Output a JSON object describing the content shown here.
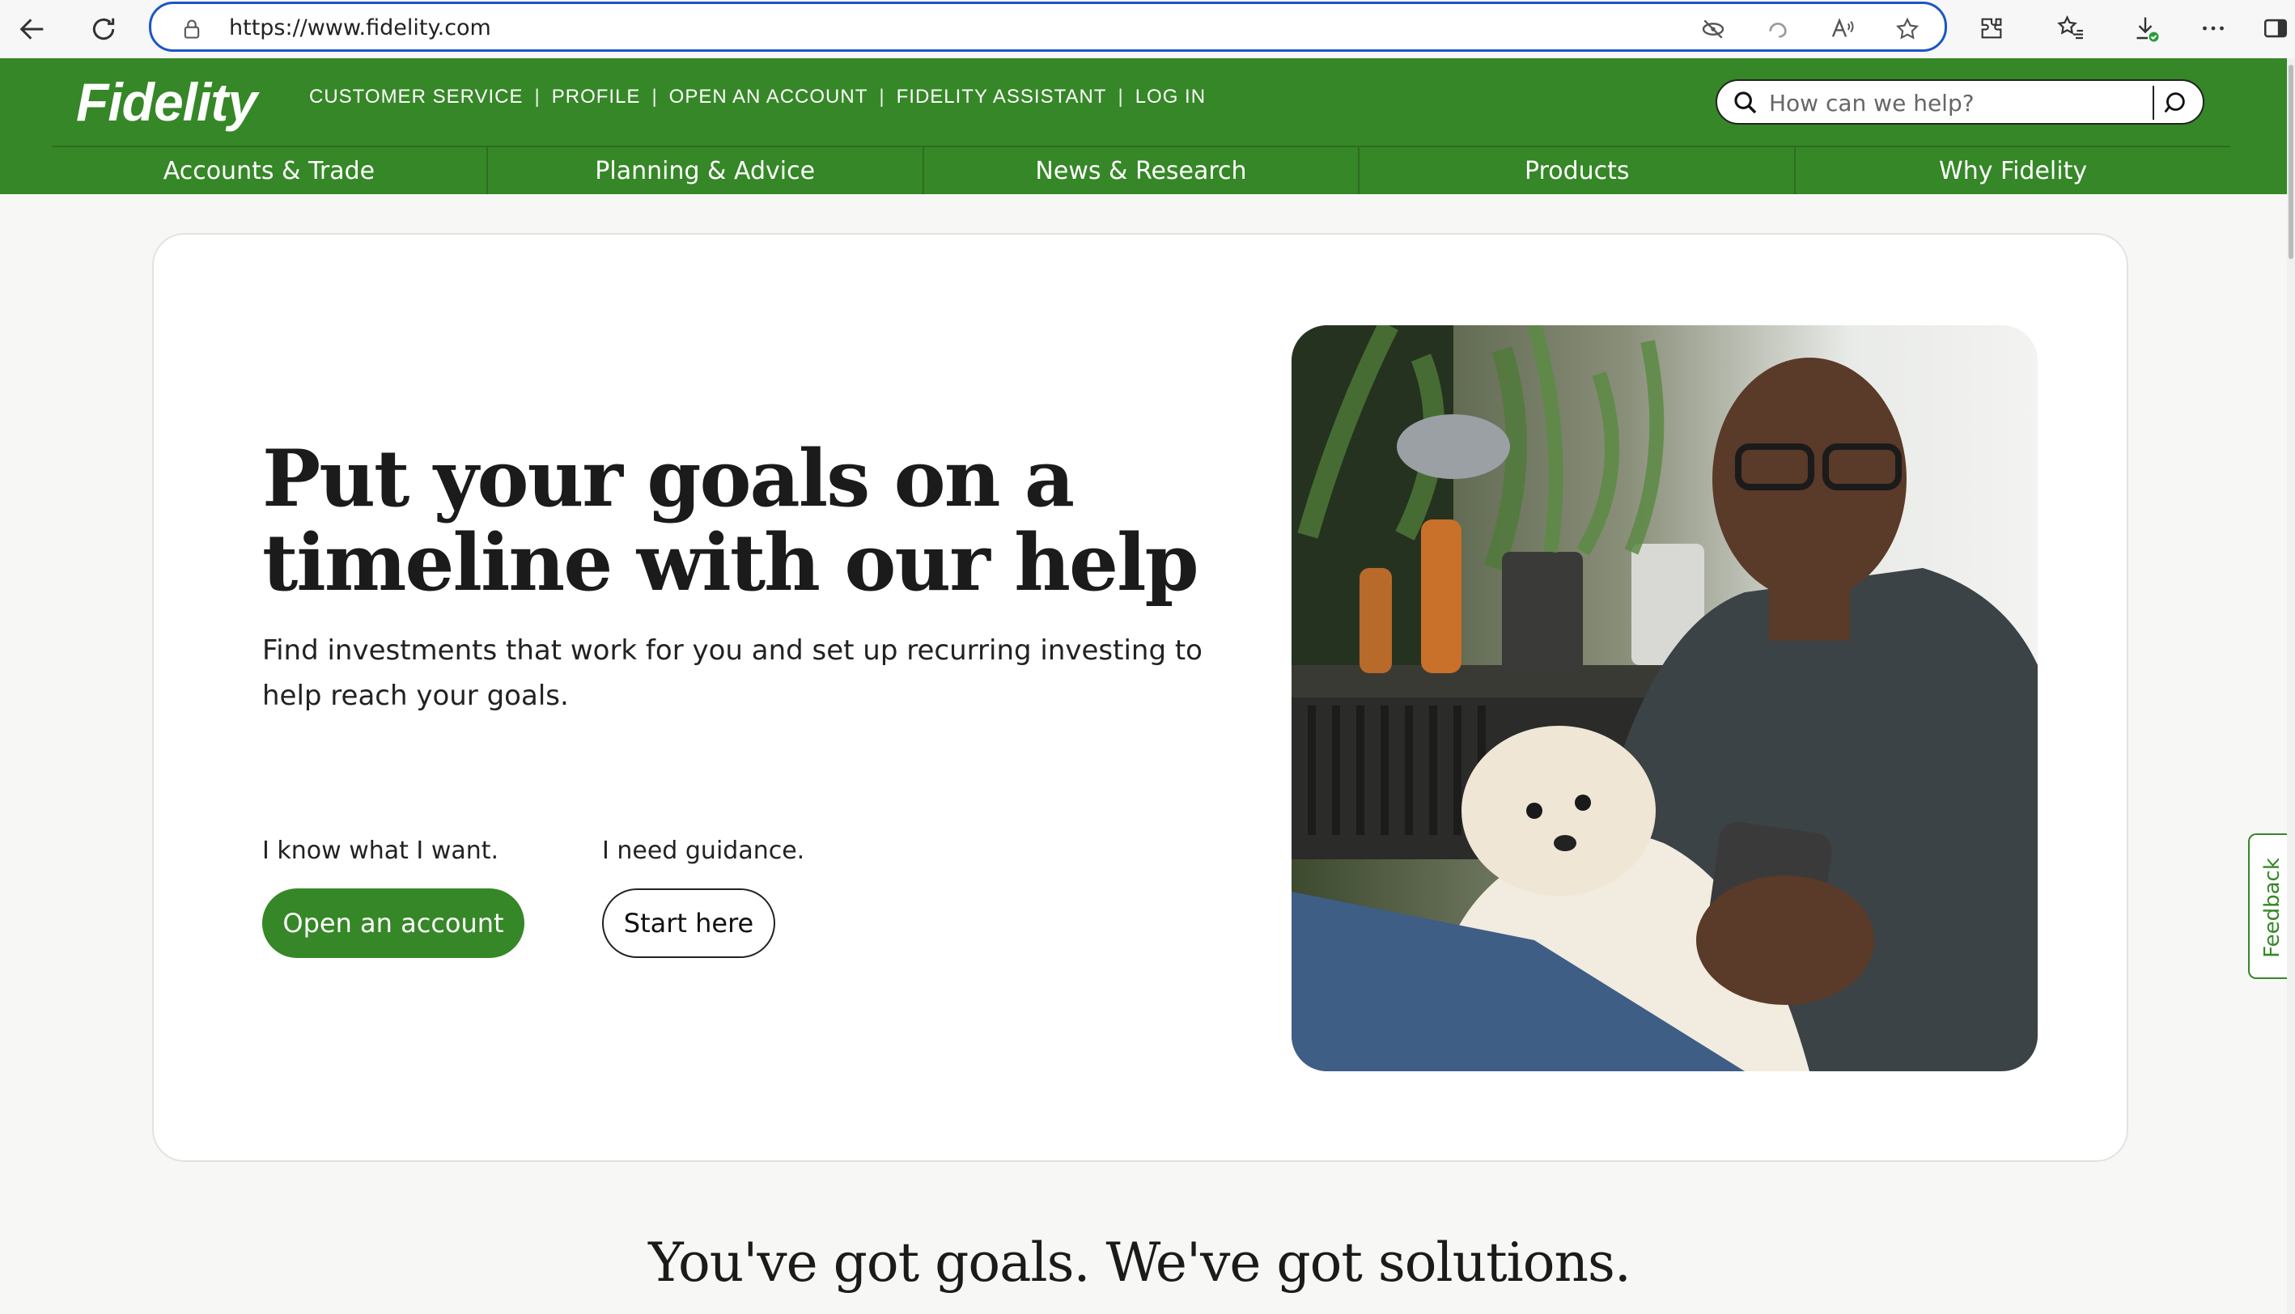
{
  "browser": {
    "url": "https://www.fidelity.com",
    "icons": [
      "back-arrow-icon",
      "refresh-icon",
      "lock-icon",
      "tracking-prevention-icon",
      "edge-copilot-icon",
      "read-aloud-icon",
      "favorite-star-icon",
      "extensions-icon",
      "favorites-list-icon",
      "downloads-icon",
      "more-menu-icon",
      "sidebar-icon"
    ]
  },
  "header": {
    "logo": "Fidelity",
    "util_links": [
      "CUSTOMER SERVICE",
      "PROFILE",
      "OPEN AN ACCOUNT",
      "FIDELITY ASSISTANT",
      "LOG IN"
    ],
    "search_placeholder": "How can we help?",
    "nav": [
      "Accounts & Trade",
      "Planning & Advice",
      "News & Research",
      "Products",
      "Why Fidelity"
    ],
    "brand_color": "#368727"
  },
  "hero": {
    "title": "Put your goals on a timeline with our help",
    "subtitle": "Find investments that work for you and set up recurring investing to help reach your goals.",
    "choice_left_label": "I know what I want.",
    "choice_right_label": "I need guidance.",
    "primary_button": "Open an account",
    "secondary_button": "Start here"
  },
  "feedback": "Feedback",
  "section_heading": "You've got goals. We've got solutions."
}
